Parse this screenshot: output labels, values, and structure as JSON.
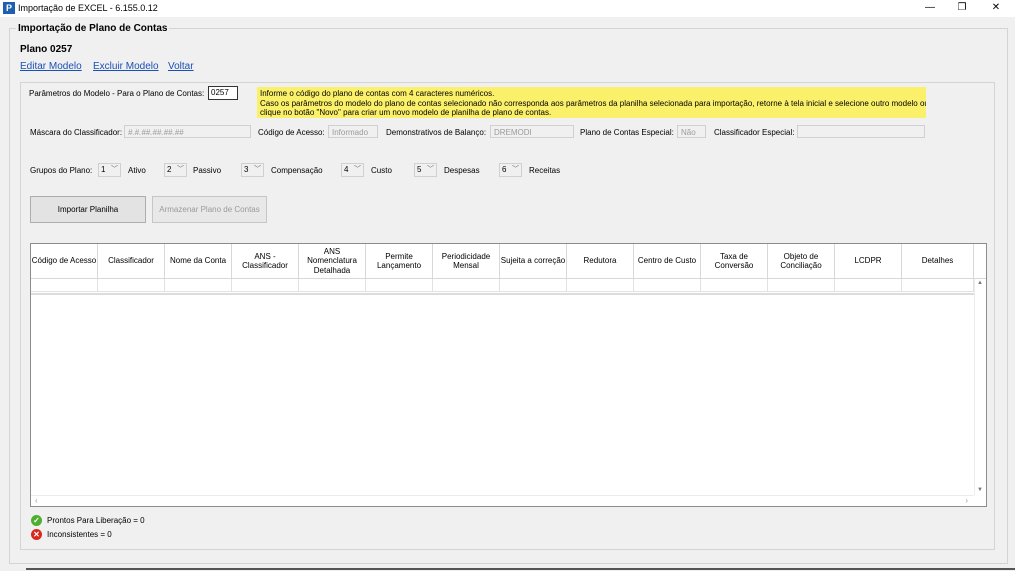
{
  "window": {
    "title": "Importação de EXCEL - 6.155.0.12",
    "minimize": "—",
    "restore": "❐",
    "close": "✕"
  },
  "group_title": "Importação de Plano de Contas",
  "plano_title": "Plano 0257",
  "links": {
    "edit": "Editar Modelo",
    "delete": "Excluir Modelo",
    "back": "Voltar"
  },
  "params": {
    "label": "Parâmetros do Modelo - Para o Plano de Contas:",
    "value": "0257",
    "info_line1": "Informe o código do plano de contas com 4 caracteres numéricos.",
    "info_line2": "Caso os parâmetros do modelo do plano de contas selecionado não corresponda aos parâmetros da planilha selecionada para importação, retorne à tela inicial e selecione outro modelo ou",
    "info_line3": "clique no botão \"Novo\" para criar um novo modelo de planilha de plano de contas."
  },
  "fields": {
    "mascara_label": "Máscara do Classificador:",
    "mascara_value": "#.#.##.##.##.##",
    "codigo_label": "Código de Acesso:",
    "codigo_value": "Informado",
    "demo_label": "Demonstrativos de Balanço:",
    "demo_value": "DREMODI",
    "especial_label": "Plano de Contas Especial:",
    "especial_value": "Não",
    "classif_label": "Classificador Especial:",
    "classif_value": ""
  },
  "groups": {
    "label": "Grupos do Plano:",
    "items": [
      {
        "value": "1",
        "label": "Ativo"
      },
      {
        "value": "2",
        "label": "Passivo"
      },
      {
        "value": "3",
        "label": "Compensação"
      },
      {
        "value": "4",
        "label": "Custo"
      },
      {
        "value": "5",
        "label": "Despesas"
      },
      {
        "value": "6",
        "label": "Receitas"
      }
    ]
  },
  "buttons": {
    "import": "Importar Planilha",
    "store": "Armazenar Plano de Contas"
  },
  "grid": {
    "columns": [
      "Código de Acesso",
      "Classificador",
      "Nome da Conta",
      "ANS - Classificador",
      "ANS Nomenclatura Detalhada",
      "Permite Lançamento",
      "Periodicidade Mensal",
      "Sujeita a correção",
      "Redutora",
      "Centro de Custo",
      "Taxa de Conversão",
      "Objeto de Conciliação",
      "LCDPR",
      "Detalhes"
    ]
  },
  "status": {
    "ready": "Prontos Para Liberação = 0",
    "inconsistent": "Inconsistentes = 0",
    "ready_color": "#4caf30",
    "inconsistent_color": "#d9281e"
  }
}
